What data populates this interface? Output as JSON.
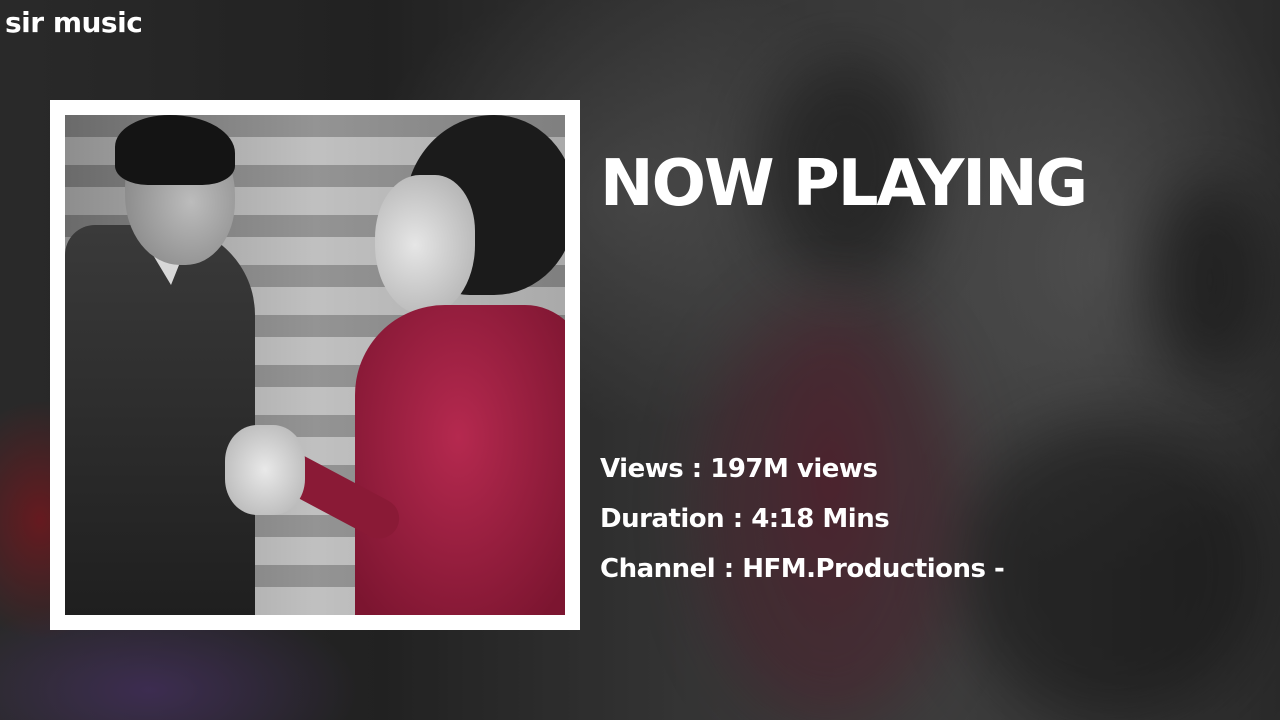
{
  "brand": {
    "name": "sir music"
  },
  "heading": {
    "title": "NOW PLAYING"
  },
  "track": {
    "views_label": "Views",
    "views_value": "197M views",
    "duration_label": "Duration",
    "duration_value": "4:18 Mins",
    "channel_label": "Channel",
    "channel_value": "HFM.Productions -",
    "separator": " : "
  },
  "colors": {
    "text": "#ffffff",
    "frame": "#ffffff",
    "dress_accent": "#b5294f"
  }
}
